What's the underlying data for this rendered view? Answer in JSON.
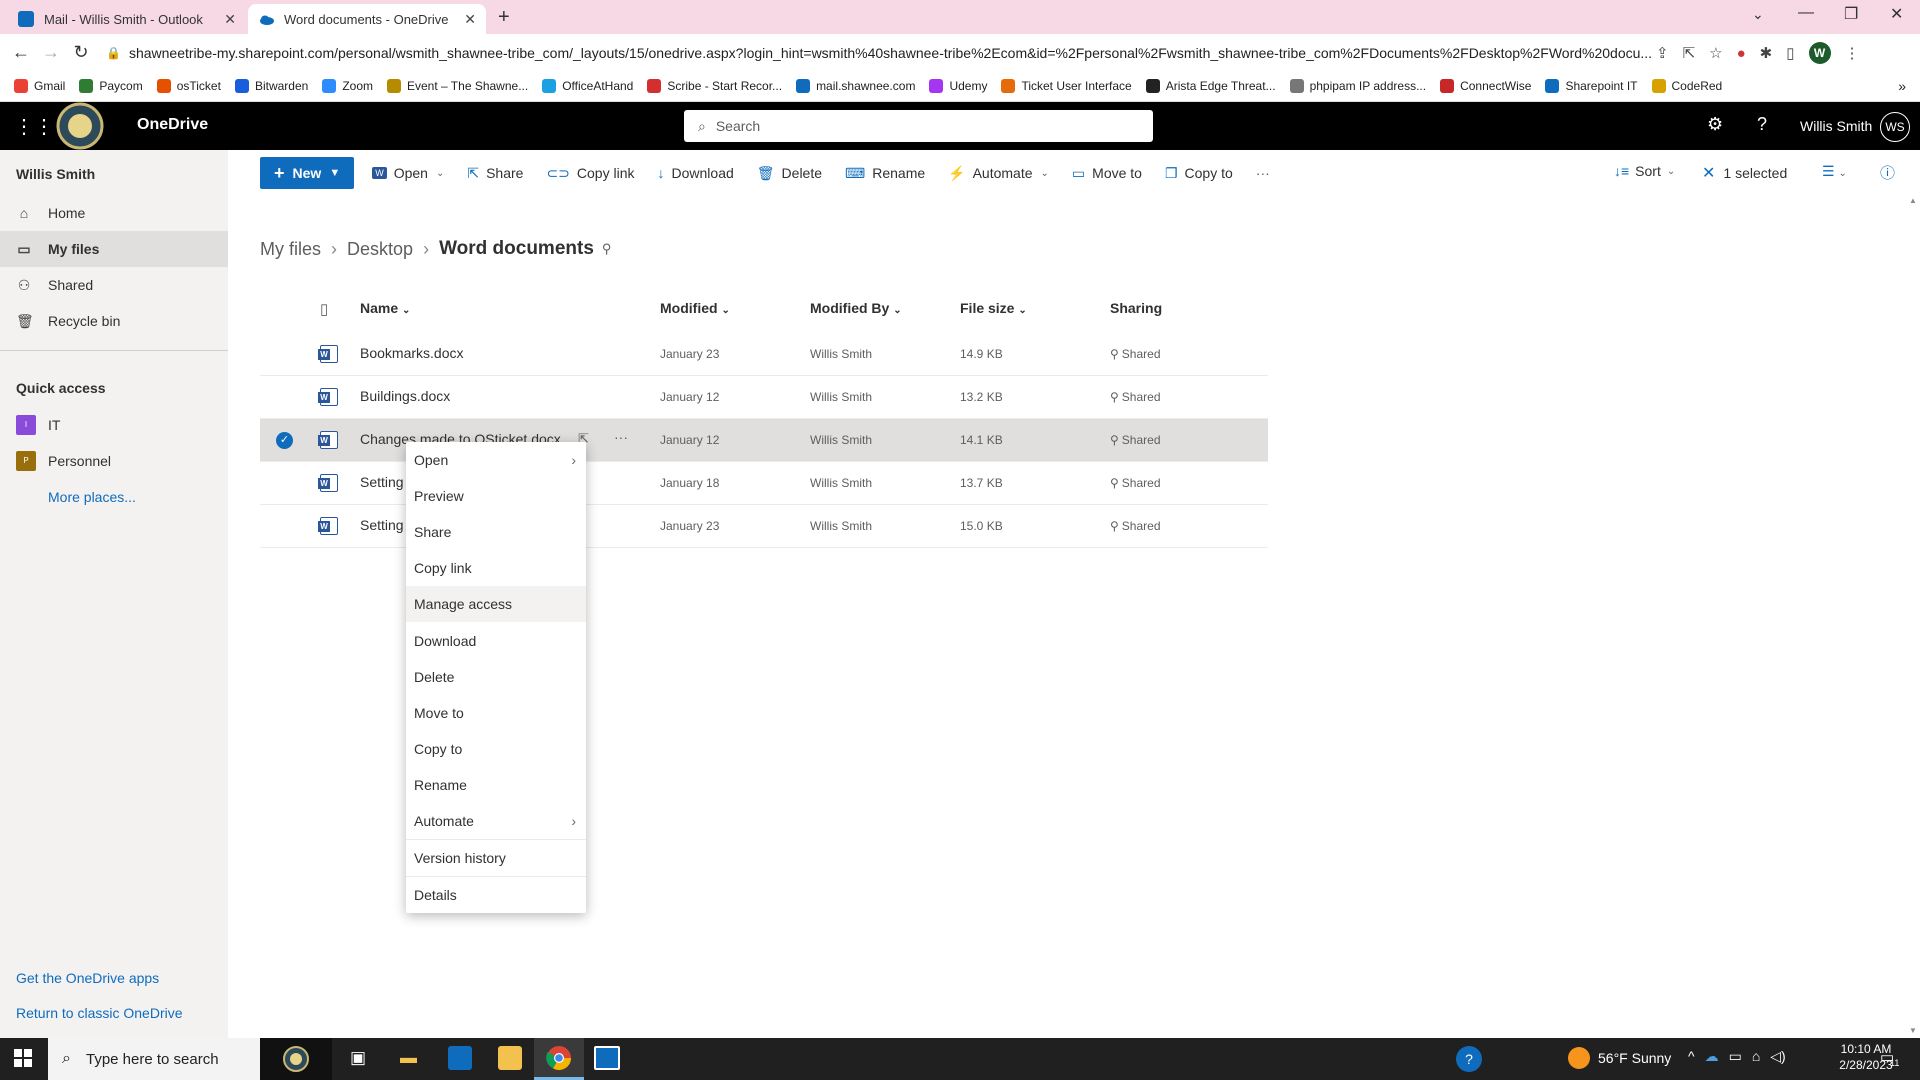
{
  "browser": {
    "tabs": [
      {
        "title": "Mail - Willis Smith - Outlook"
      },
      {
        "title": "Word documents - OneDrive"
      }
    ],
    "url": "shawneetribe-my.sharepoint.com/personal/wsmith_shawnee-tribe_com/_layouts/15/onedrive.aspx?login_hint=wsmith%40shawnee-tribe%2Ecom&id=%2Fpersonal%2Fwsmith_shawnee-tribe_com%2FDocuments%2FDesktop%2FWord%20docu...",
    "profile_initial": "W",
    "bookmarks": [
      "Gmail",
      "Paycom",
      "osTicket",
      "Bitwarden",
      "Zoom",
      "Event – The Shawne...",
      "OfficeAtHand",
      "Scribe - Start Recor...",
      "mail.shawnee.com",
      "Udemy",
      "Ticket User Interface",
      "Arista Edge Threat...",
      "phpipam IP address...",
      "ConnectWise",
      "Sharepoint IT",
      "CodeRed"
    ]
  },
  "app": {
    "name": "OneDrive",
    "search_placeholder": "Search",
    "user_name": "Willis Smith",
    "user_initials": "WS"
  },
  "leftnav": {
    "user": "Willis Smith",
    "items": [
      {
        "label": "Home"
      },
      {
        "label": "My files"
      },
      {
        "label": "Shared"
      },
      {
        "label": "Recycle bin"
      }
    ],
    "quick_access_title": "Quick access",
    "quick_access": [
      {
        "letter": "I",
        "label": "IT",
        "color": "#8a4bdb"
      },
      {
        "letter": "P",
        "label": "Personnel",
        "color": "#986f0b"
      }
    ],
    "more_places": "More places...",
    "get_apps": "Get the OneDrive apps",
    "return_classic": "Return to classic OneDrive"
  },
  "commands": {
    "new": "New",
    "open": "Open",
    "share": "Share",
    "copy_link": "Copy link",
    "download": "Download",
    "delete": "Delete",
    "rename": "Rename",
    "automate": "Automate",
    "move_to": "Move to",
    "copy_to": "Copy to",
    "more": "···",
    "sort": "Sort",
    "selected": "1 selected"
  },
  "breadcrumb": [
    "My files",
    "Desktop",
    "Word documents"
  ],
  "columns": {
    "name": "Name",
    "modified": "Modified",
    "modified_by": "Modified By",
    "file_size": "File size",
    "sharing": "Sharing"
  },
  "files": [
    {
      "name": "Bookmarks.docx",
      "modified": "January 23",
      "by": "Willis Smith",
      "size": "14.9 KB",
      "sharing": "Shared"
    },
    {
      "name": "Buildings.docx",
      "modified": "January 12",
      "by": "Willis Smith",
      "size": "13.2 KB",
      "sharing": "Shared"
    },
    {
      "name": "Changes made to OSticket.docx",
      "modified": "January 12",
      "by": "Willis Smith",
      "size": "14.1 KB",
      "sharing": "Shared"
    },
    {
      "name": "Setting",
      "modified": "January 18",
      "by": "Willis Smith",
      "size": "13.7 KB",
      "sharing": "Shared"
    },
    {
      "name": "Setting",
      "modified": "January 23",
      "by": "Willis Smith",
      "size": "15.0 KB",
      "sharing": "Shared"
    }
  ],
  "context_menu": [
    "Open",
    "Preview",
    "Share",
    "Copy link",
    "Manage access",
    "Download",
    "Delete",
    "Move to",
    "Copy to",
    "Rename",
    "Automate",
    "Version history",
    "Details"
  ],
  "taskbar": {
    "search_placeholder": "Type here to search",
    "weather": "56°F  Sunny",
    "time": "10:10 AM",
    "date": "2/28/2023",
    "notifications": "11"
  }
}
